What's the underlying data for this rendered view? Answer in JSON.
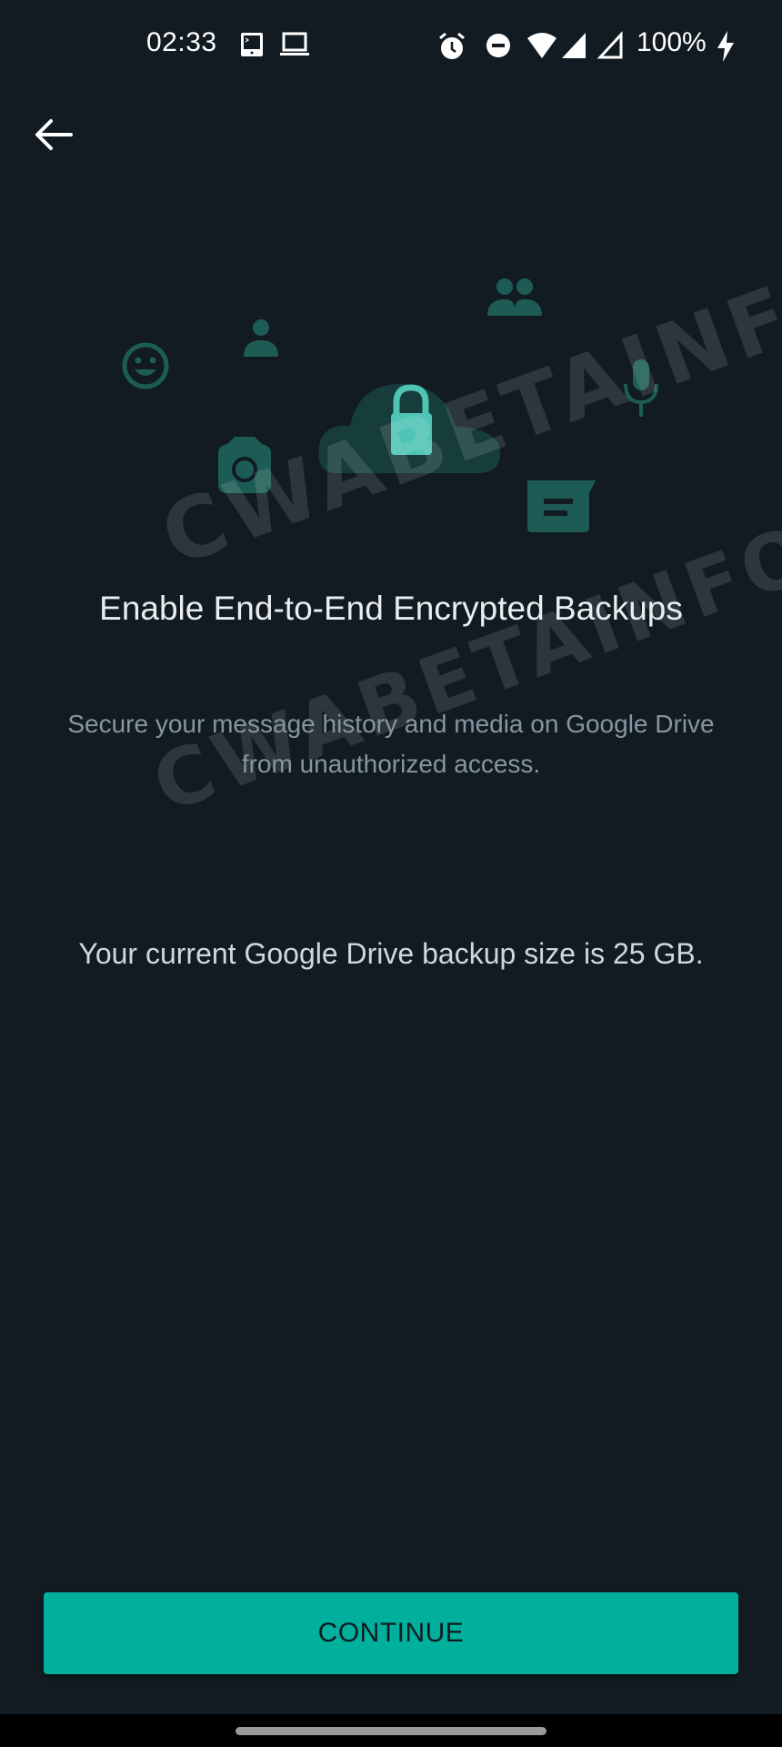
{
  "status_bar": {
    "time": "02:33",
    "battery": "100%",
    "icons": [
      "terminal-icon",
      "laptop-icon",
      "alarm-icon",
      "do-not-disturb-icon",
      "wifi-icon",
      "signal-icon",
      "signal-empty-icon",
      "charging-icon"
    ]
  },
  "header": {
    "back_icon": "arrow-left-icon"
  },
  "illustration": {
    "icons": [
      "emoji-icon",
      "person-icon",
      "group-icon",
      "cloud-icon",
      "lock-icon",
      "camera-icon",
      "microphone-icon",
      "message-icon"
    ],
    "watermark": "CWABETAINFO"
  },
  "content": {
    "title": "Enable End-to-End Encrypted Backups",
    "subtitle": "Secure your message history and media on Google Drive from unauthorized access.",
    "backup_size_text": "Your current Google Drive backup size is 25 GB."
  },
  "footer": {
    "continue_label": "CONTINUE"
  },
  "colors": {
    "background": "#111b21",
    "accent": "#00af9c",
    "illustration": "#1d5c55",
    "lock": "#4fc3b4"
  }
}
